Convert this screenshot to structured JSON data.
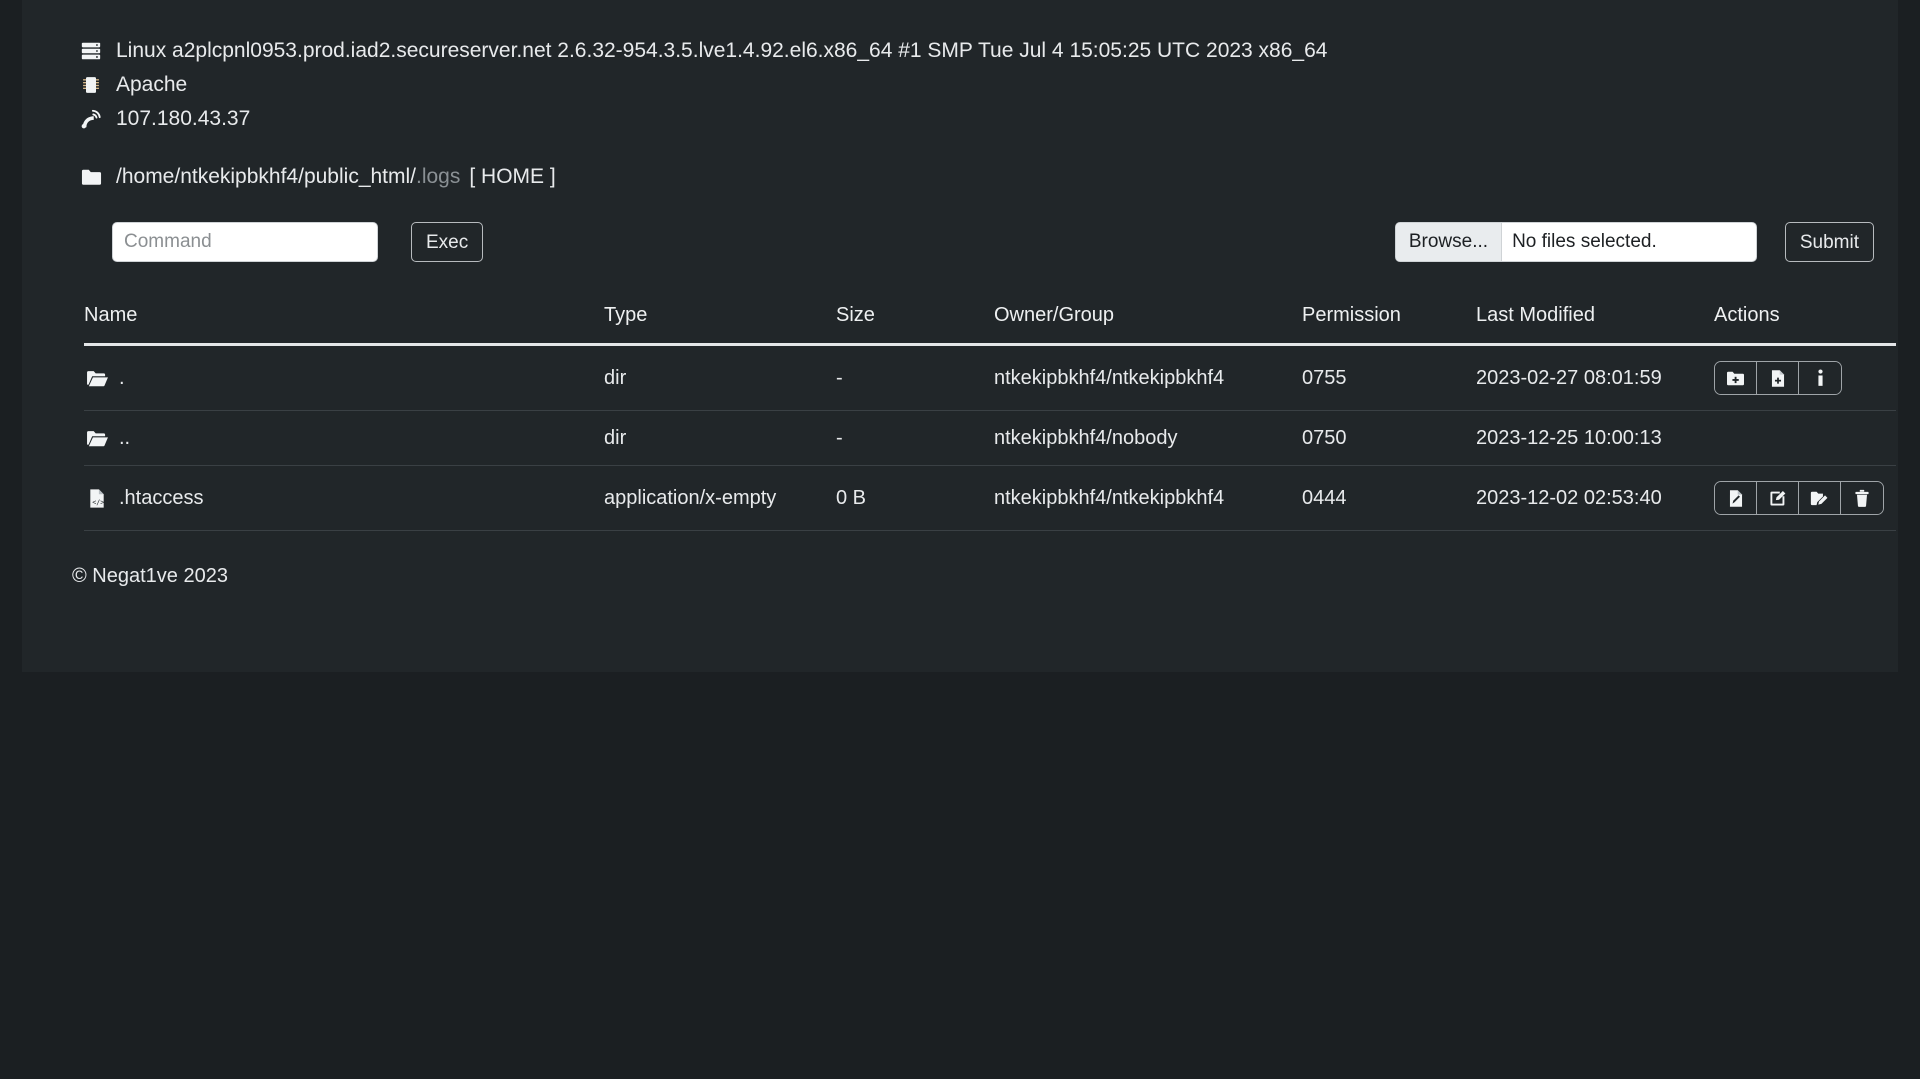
{
  "server": {
    "os_icon": "server-icon",
    "os_line": "Linux a2plcpnl0953.prod.iad2.secureserver.net 2.6.32-954.3.5.lve1.4.92.el6.x86_64 #1 SMP Tue Jul 4 15:05:25 UTC 2023 x86_64",
    "software_icon": "cpu-icon",
    "software_line": "Apache",
    "ip_icon": "satellite-dish-icon",
    "ip_line": "107.180.43.37"
  },
  "path": {
    "folder_icon": "folder-icon",
    "base": "/home/ntkekipbkhf4/public_html/",
    "current": ".logs",
    "home_label": "[ HOME ]"
  },
  "toolbar": {
    "command_placeholder": "Command",
    "command_value": "",
    "exec_label": "Exec",
    "browse_label": "Browse...",
    "file_status": "No files selected.",
    "submit_label": "Submit"
  },
  "table": {
    "headers": [
      "Name",
      "Type",
      "Size",
      "Owner/Group",
      "Permission",
      "Last Modified",
      "Actions"
    ],
    "rows": [
      {
        "icon": "folder-open-icon",
        "name": ".",
        "type": "dir",
        "size": "-",
        "owner": "ntkekipbkhf4/ntkekipbkhf4",
        "permission": "0755",
        "modified": "2023-02-27 08:01:59",
        "actions": [
          "new-folder-icon",
          "new-file-icon",
          "info-icon"
        ]
      },
      {
        "icon": "folder-open-icon",
        "name": "..",
        "type": "dir",
        "size": "-",
        "owner": "ntkekipbkhf4/nobody",
        "permission": "0750",
        "modified": "2023-12-25 10:00:13",
        "actions": []
      },
      {
        "icon": "file-code-icon",
        "name": ".htaccess",
        "type": "application/x-empty",
        "size": "0 B",
        "owner": "ntkekipbkhf4/ntkekipbkhf4",
        "permission": "0444",
        "modified": "2023-12-02 02:53:40",
        "actions": [
          "download-file-icon",
          "edit-icon",
          "rename-icon",
          "delete-icon"
        ]
      }
    ]
  },
  "footer": {
    "copyright": "© Negat1ve 2023"
  },
  "colors": {
    "page_background": "#1b1f22",
    "panel_background": "#212629",
    "text": "#e8eaec",
    "muted_text": "#8a9094",
    "row_divider": "#3a4044",
    "header_rule": "#e4e6e8"
  }
}
